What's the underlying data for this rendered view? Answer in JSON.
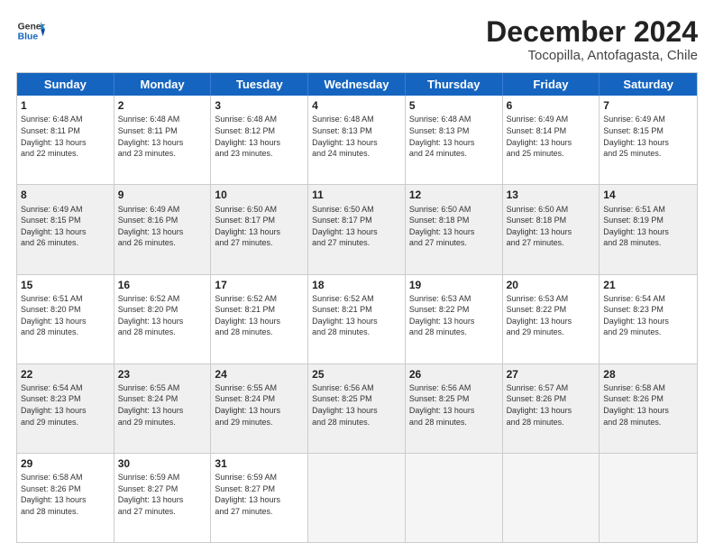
{
  "logo": {
    "line1": "General",
    "line2": "Blue"
  },
  "title": "December 2024",
  "subtitle": "Tocopilla, Antofagasta, Chile",
  "header_days": [
    "Sunday",
    "Monday",
    "Tuesday",
    "Wednesday",
    "Thursday",
    "Friday",
    "Saturday"
  ],
  "weeks": [
    [
      {
        "day": "1",
        "text": "Sunrise: 6:48 AM\nSunset: 8:11 PM\nDaylight: 13 hours\nand 22 minutes."
      },
      {
        "day": "2",
        "text": "Sunrise: 6:48 AM\nSunset: 8:11 PM\nDaylight: 13 hours\nand 23 minutes."
      },
      {
        "day": "3",
        "text": "Sunrise: 6:48 AM\nSunset: 8:12 PM\nDaylight: 13 hours\nand 23 minutes."
      },
      {
        "day": "4",
        "text": "Sunrise: 6:48 AM\nSunset: 8:13 PM\nDaylight: 13 hours\nand 24 minutes."
      },
      {
        "day": "5",
        "text": "Sunrise: 6:48 AM\nSunset: 8:13 PM\nDaylight: 13 hours\nand 24 minutes."
      },
      {
        "day": "6",
        "text": "Sunrise: 6:49 AM\nSunset: 8:14 PM\nDaylight: 13 hours\nand 25 minutes."
      },
      {
        "day": "7",
        "text": "Sunrise: 6:49 AM\nSunset: 8:15 PM\nDaylight: 13 hours\nand 25 minutes."
      }
    ],
    [
      {
        "day": "8",
        "text": "Sunrise: 6:49 AM\nSunset: 8:15 PM\nDaylight: 13 hours\nand 26 minutes."
      },
      {
        "day": "9",
        "text": "Sunrise: 6:49 AM\nSunset: 8:16 PM\nDaylight: 13 hours\nand 26 minutes."
      },
      {
        "day": "10",
        "text": "Sunrise: 6:50 AM\nSunset: 8:17 PM\nDaylight: 13 hours\nand 27 minutes."
      },
      {
        "day": "11",
        "text": "Sunrise: 6:50 AM\nSunset: 8:17 PM\nDaylight: 13 hours\nand 27 minutes."
      },
      {
        "day": "12",
        "text": "Sunrise: 6:50 AM\nSunset: 8:18 PM\nDaylight: 13 hours\nand 27 minutes."
      },
      {
        "day": "13",
        "text": "Sunrise: 6:50 AM\nSunset: 8:18 PM\nDaylight: 13 hours\nand 27 minutes."
      },
      {
        "day": "14",
        "text": "Sunrise: 6:51 AM\nSunset: 8:19 PM\nDaylight: 13 hours\nand 28 minutes."
      }
    ],
    [
      {
        "day": "15",
        "text": "Sunrise: 6:51 AM\nSunset: 8:20 PM\nDaylight: 13 hours\nand 28 minutes."
      },
      {
        "day": "16",
        "text": "Sunrise: 6:52 AM\nSunset: 8:20 PM\nDaylight: 13 hours\nand 28 minutes."
      },
      {
        "day": "17",
        "text": "Sunrise: 6:52 AM\nSunset: 8:21 PM\nDaylight: 13 hours\nand 28 minutes."
      },
      {
        "day": "18",
        "text": "Sunrise: 6:52 AM\nSunset: 8:21 PM\nDaylight: 13 hours\nand 28 minutes."
      },
      {
        "day": "19",
        "text": "Sunrise: 6:53 AM\nSunset: 8:22 PM\nDaylight: 13 hours\nand 28 minutes."
      },
      {
        "day": "20",
        "text": "Sunrise: 6:53 AM\nSunset: 8:22 PM\nDaylight: 13 hours\nand 29 minutes."
      },
      {
        "day": "21",
        "text": "Sunrise: 6:54 AM\nSunset: 8:23 PM\nDaylight: 13 hours\nand 29 minutes."
      }
    ],
    [
      {
        "day": "22",
        "text": "Sunrise: 6:54 AM\nSunset: 8:23 PM\nDaylight: 13 hours\nand 29 minutes."
      },
      {
        "day": "23",
        "text": "Sunrise: 6:55 AM\nSunset: 8:24 PM\nDaylight: 13 hours\nand 29 minutes."
      },
      {
        "day": "24",
        "text": "Sunrise: 6:55 AM\nSunset: 8:24 PM\nDaylight: 13 hours\nand 29 minutes."
      },
      {
        "day": "25",
        "text": "Sunrise: 6:56 AM\nSunset: 8:25 PM\nDaylight: 13 hours\nand 28 minutes."
      },
      {
        "day": "26",
        "text": "Sunrise: 6:56 AM\nSunset: 8:25 PM\nDaylight: 13 hours\nand 28 minutes."
      },
      {
        "day": "27",
        "text": "Sunrise: 6:57 AM\nSunset: 8:26 PM\nDaylight: 13 hours\nand 28 minutes."
      },
      {
        "day": "28",
        "text": "Sunrise: 6:58 AM\nSunset: 8:26 PM\nDaylight: 13 hours\nand 28 minutes."
      }
    ],
    [
      {
        "day": "29",
        "text": "Sunrise: 6:58 AM\nSunset: 8:26 PM\nDaylight: 13 hours\nand 28 minutes."
      },
      {
        "day": "30",
        "text": "Sunrise: 6:59 AM\nSunset: 8:27 PM\nDaylight: 13 hours\nand 27 minutes."
      },
      {
        "day": "31",
        "text": "Sunrise: 6:59 AM\nSunset: 8:27 PM\nDaylight: 13 hours\nand 27 minutes."
      },
      {
        "day": "",
        "text": ""
      },
      {
        "day": "",
        "text": ""
      },
      {
        "day": "",
        "text": ""
      },
      {
        "day": "",
        "text": ""
      }
    ]
  ]
}
